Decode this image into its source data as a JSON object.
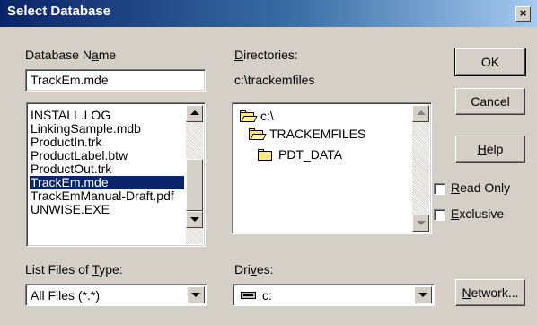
{
  "window": {
    "title": "Select Database",
    "close_glyph": "×"
  },
  "database_name": {
    "label_pre": "Database N",
    "label_key": "a",
    "label_post": "me",
    "value": "TrackEm.mde"
  },
  "directories": {
    "label_key": "D",
    "label_post": "irectories:",
    "current_path": "c:\\trackemfiles"
  },
  "files": {
    "items": [
      "INSTALL.LOG",
      "LinkingSample.mdb",
      "ProductIn.trk",
      "ProductLabel.btw",
      "ProductOut.trk",
      "TrackEm.mde",
      "TrackEmManual-Draft.pdf",
      "UNWISE.EXE"
    ],
    "selected": "TrackEm.mde"
  },
  "folders": [
    {
      "name": "c:\\",
      "state": "open",
      "icon": "open-folder-icon"
    },
    {
      "name": "TRACKEMFILES",
      "state": "open",
      "icon": "open-folder-icon"
    },
    {
      "name": "PDT_DATA",
      "state": "closed",
      "icon": "folder-icon"
    }
  ],
  "file_type": {
    "label_pre": "List Files of ",
    "label_key": "T",
    "label_post": "ype:",
    "value": "All Files (*.*)"
  },
  "drives": {
    "label_pre": "Dri",
    "label_key": "v",
    "label_post": "es:",
    "value": "c:",
    "icon": "drive-icon"
  },
  "buttons": {
    "ok": "OK",
    "cancel": "Cancel",
    "help_key": "H",
    "help_post": "elp",
    "network_key": "N",
    "network_post": "etwork..."
  },
  "options": {
    "read_only": {
      "key": "R",
      "post": "ead Only",
      "checked": false
    },
    "exclusive": {
      "key": "E",
      "post": "xclusive",
      "checked": false
    }
  },
  "colors": {
    "title_bar": "#0a246a",
    "selection": "#0a246a",
    "face": "#d4d0c8"
  }
}
